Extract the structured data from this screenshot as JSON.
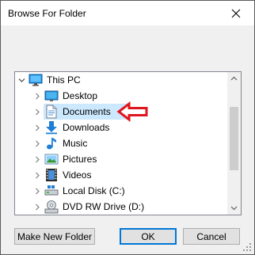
{
  "window": {
    "title": "Browse For Folder"
  },
  "tree": {
    "items": [
      {
        "label": "This PC",
        "icon": "this-pc-icon",
        "expanded": true
      },
      {
        "label": "Desktop",
        "icon": "desktop-folder-icon"
      },
      {
        "label": "Documents",
        "icon": "documents-icon",
        "selected": true
      },
      {
        "label": "Downloads",
        "icon": "downloads-icon"
      },
      {
        "label": "Music",
        "icon": "music-icon"
      },
      {
        "label": "Pictures",
        "icon": "pictures-icon"
      },
      {
        "label": "Videos",
        "icon": "videos-icon"
      },
      {
        "label": "Local Disk (C:)",
        "icon": "local-disk-icon"
      },
      {
        "label": "DVD RW Drive (D:)",
        "icon": "dvd-drive-icon"
      }
    ]
  },
  "annotation": {
    "arrow_color": "#e0161e"
  },
  "buttons": {
    "make_new_folder": "Make New Folder",
    "ok": "OK",
    "cancel": "Cancel"
  },
  "colors": {
    "selection": "#cce8ff",
    "default_button_border": "#0078d7"
  }
}
